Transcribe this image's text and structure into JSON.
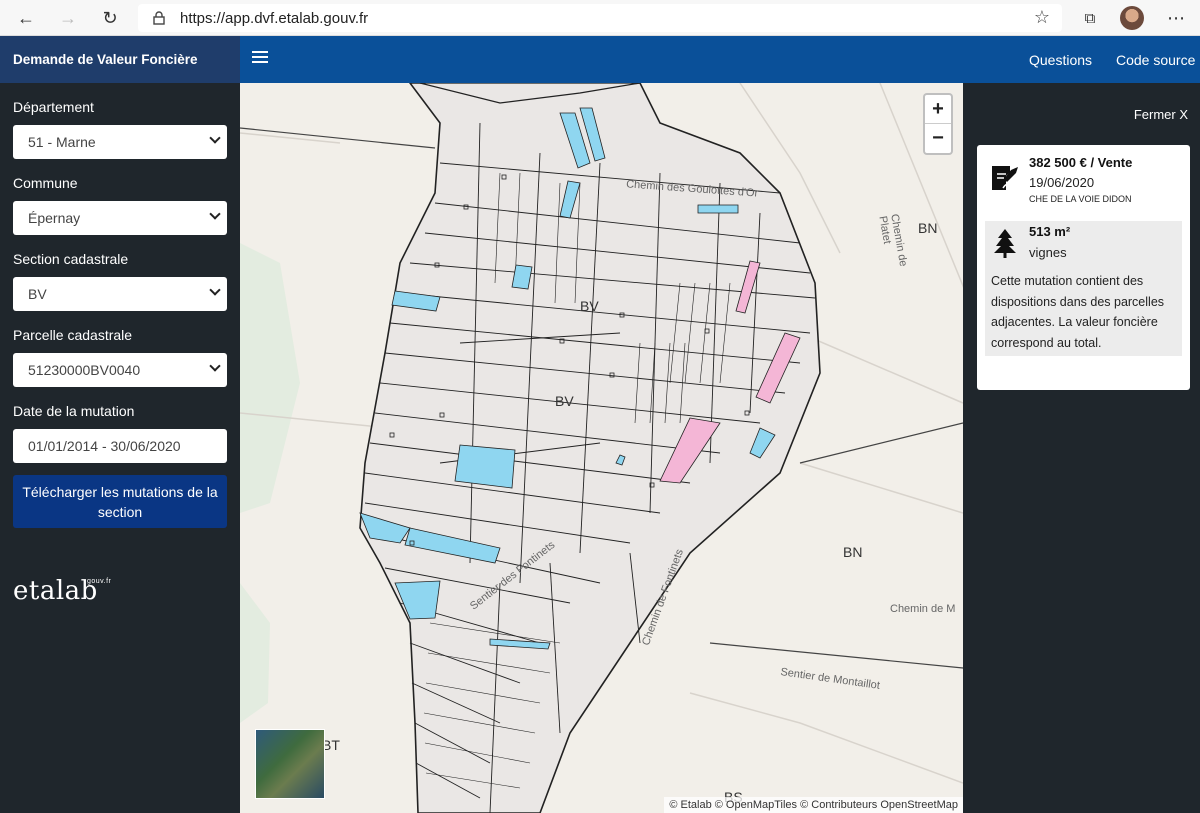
{
  "browser": {
    "url": "https://app.dvf.etalab.gouv.fr"
  },
  "header": {
    "title": "Demande de Valeur Foncière",
    "links": [
      "Questions",
      "Code source"
    ]
  },
  "sidebar": {
    "departement_label": "Département",
    "departement_value": "51 - Marne",
    "commune_label": "Commune",
    "commune_value": "Épernay",
    "section_label": "Section cadastrale",
    "section_value": "BV",
    "parcelle_label": "Parcelle cadastrale",
    "parcelle_value": "51230000BV0040",
    "date_label": "Date de la mutation",
    "date_value": "01/01/2014 - 30/06/2020",
    "download_label": "Télécharger les mutations de la section",
    "logo": "etalab",
    "logo_sup": "gouv.fr"
  },
  "map": {
    "zoom_in": "+",
    "zoom_out": "−",
    "labels": {
      "bv1": "BV",
      "bv2": "BV",
      "bn1": "BN",
      "bn2": "BN",
      "bt": "BT",
      "bs": "BS",
      "street1": "Chemin des Goulottes d'Or",
      "street2": "Chemin de Platet",
      "street3": "Sentier des Fontinets",
      "street4": "Chemin de Fontinets",
      "street5": "Chemin de M",
      "street6": "Sentier de Montaillot"
    },
    "attribution": "© Etalab © OpenMapTiles © Contributeurs OpenStreetMap",
    "colors": {
      "highlight_blue": "#8fd6f0",
      "highlight_pink": "#f4b6d6",
      "parcel_fill": "#eae7e5"
    }
  },
  "panel": {
    "close_label": "Fermer X",
    "price": "382 500 € / Vente",
    "date": "19/06/2020",
    "address": "CHE DE LA VOIE DIDON",
    "area": "513 m²",
    "usage": "vignes",
    "note": "Cette mutation contient des dispositions dans des parcelles adjacentes. La valeur foncière correspond au total."
  }
}
